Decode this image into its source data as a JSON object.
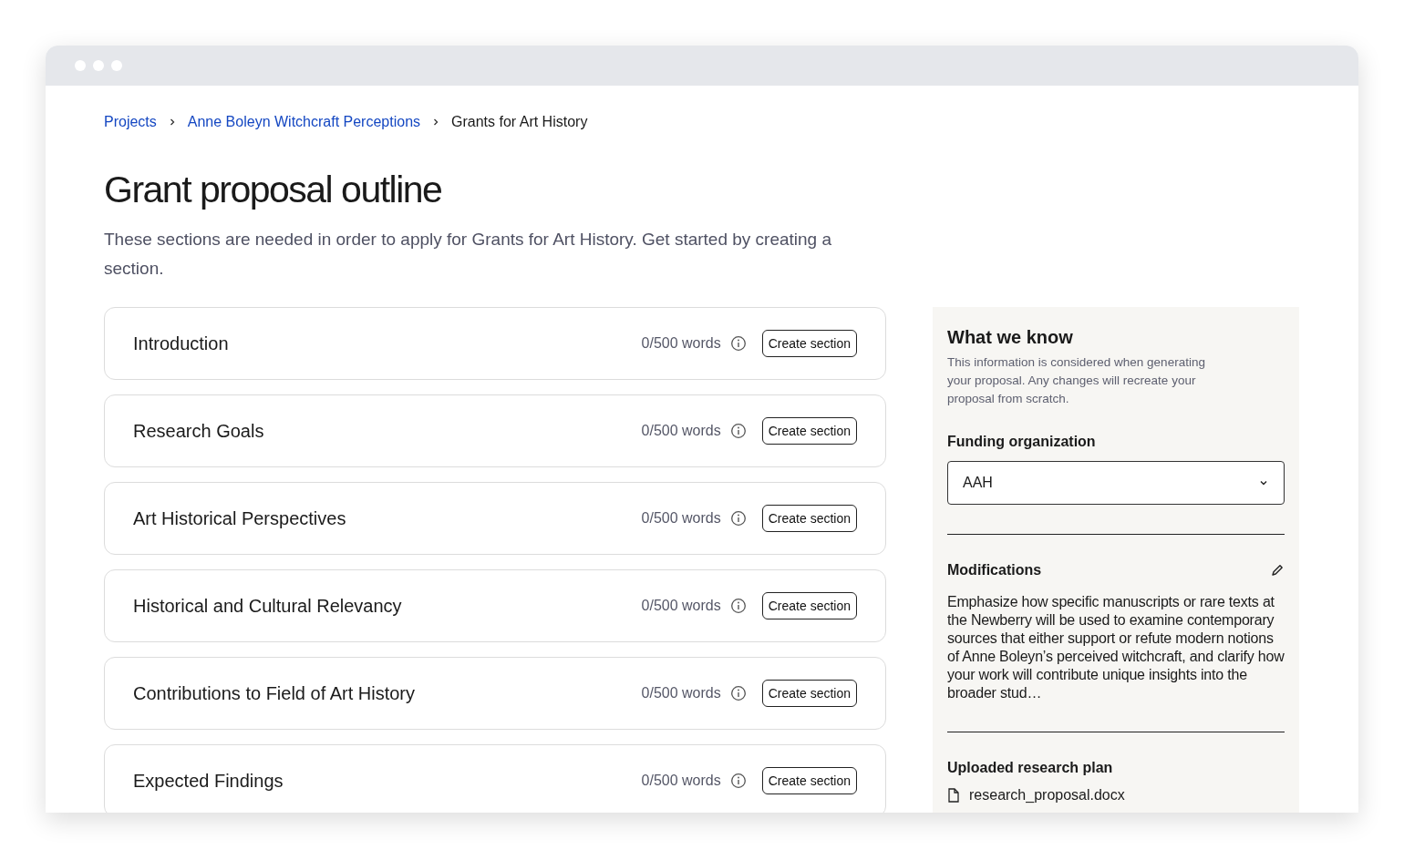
{
  "breadcrumbs": [
    {
      "label": "Projects",
      "kind": "link"
    },
    {
      "label": "Anne Boleyn Witchcraft Perceptions",
      "kind": "link"
    },
    {
      "label": "Grants for Art History",
      "kind": "current"
    }
  ],
  "title": "Grant proposal outline",
  "subtitle": "These sections are needed in order to apply for Grants for Art History. Get started by creating a section.",
  "sections": [
    {
      "title": "Introduction",
      "words": "0/500 words",
      "button": "Create section"
    },
    {
      "title": "Research Goals",
      "words": "0/500 words",
      "button": "Create section"
    },
    {
      "title": "Art Historical Perspectives",
      "words": "0/500 words",
      "button": "Create section"
    },
    {
      "title": "Historical and Cultural Relevancy",
      "words": "0/500 words",
      "button": "Create section"
    },
    {
      "title": "Contributions to Field of Art History",
      "words": "0/500 words",
      "button": "Create section"
    },
    {
      "title": "Expected Findings",
      "words": "0/500 words",
      "button": "Create section"
    }
  ],
  "panel": {
    "title": "What we know",
    "description": "This information is considered when generating your proposal. Any changes will recreate your proposal from scratch.",
    "funding_label": "Funding organization",
    "funding_value": "AAH",
    "modifications_label": "Modifications",
    "modifications_text": "Emphasize how specific manuscripts or rare texts at the Newberry will be used to examine contemporary sources that either support or refute modern notions of Anne Boleyn’s perceived witchcraft, and clarify how your work will contribute unique insights into the broader stud…",
    "upload_label": "Uploaded research plan",
    "file_name": "research_proposal.docx"
  }
}
